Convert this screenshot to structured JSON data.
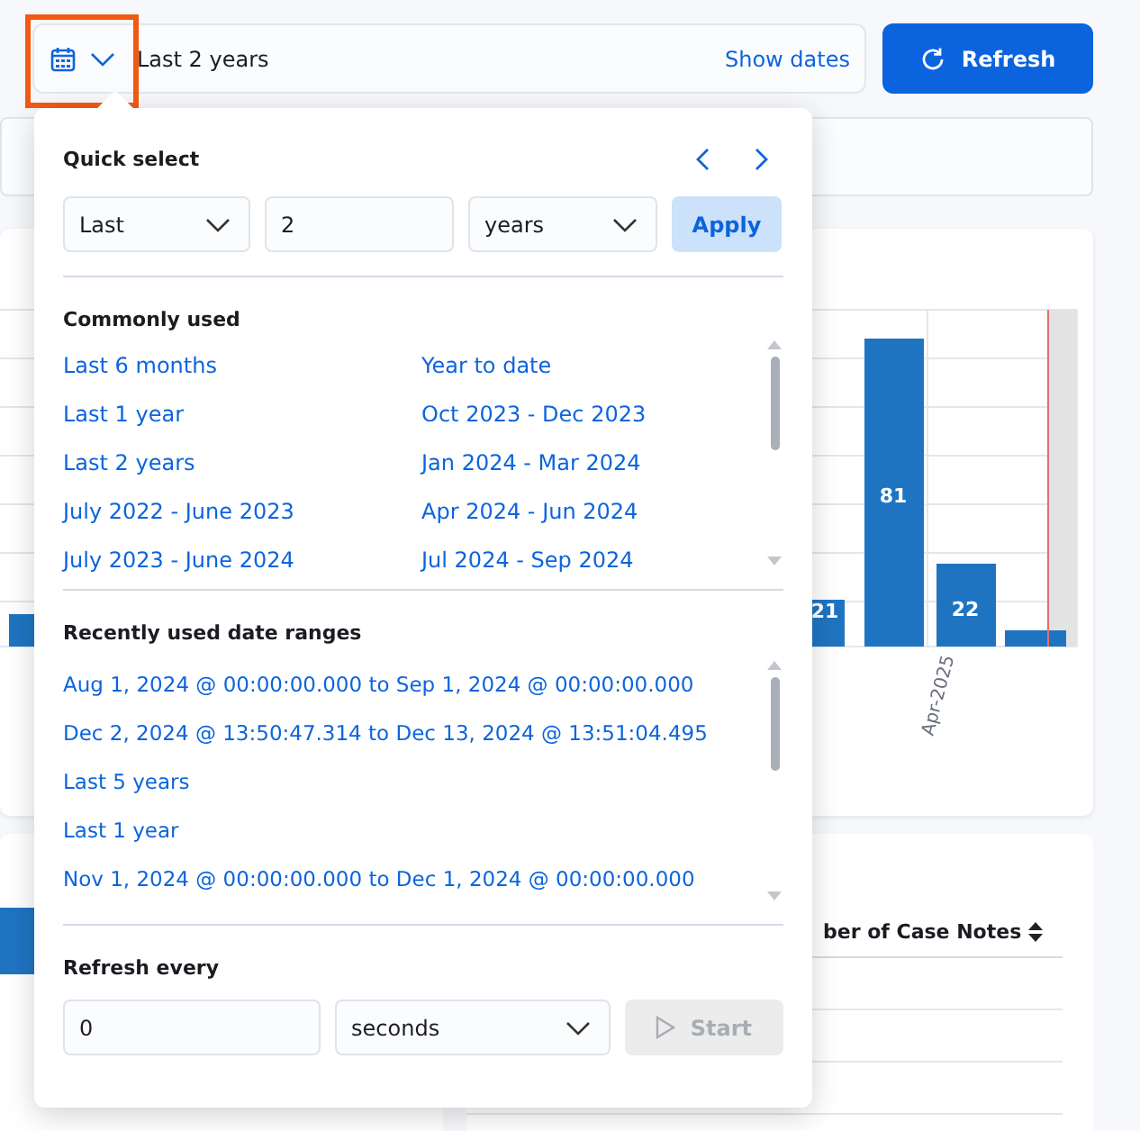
{
  "date_picker": {
    "value": "Last 2 years",
    "show_dates": "Show dates"
  },
  "refresh_button": "Refresh",
  "chart_panel": {
    "bar_labels": [
      "21",
      "81",
      "22"
    ],
    "axis_label": "Apr-2025"
  },
  "table_panel": {
    "column_header": "ber of Case Notes"
  },
  "popover": {
    "quick_select": {
      "title": "Quick select",
      "direction": "Last",
      "amount": "2",
      "unit": "years",
      "apply": "Apply"
    },
    "commonly_used": {
      "title": "Commonly used",
      "items": [
        {
          "label": "Last 6 months"
        },
        {
          "label": "Year to date"
        },
        {
          "label": "Last 1 year"
        },
        {
          "label": "Oct 2023 - Dec 2023"
        },
        {
          "label": "Last 2 years"
        },
        {
          "label": "Jan 2024 - Mar 2024"
        },
        {
          "label": "July 2022 - June 2023"
        },
        {
          "label": "Apr 2024 - Jun 2024"
        },
        {
          "label": "July 2023 - June 2024"
        },
        {
          "label": "Jul 2024 - Sep 2024"
        }
      ]
    },
    "recently_used": {
      "title": "Recently used date ranges",
      "items": [
        {
          "label": "Aug 1, 2024 @ 00:00:00.000 to Sep 1, 2024 @ 00:00:00.000"
        },
        {
          "label": "Dec 2, 2024 @ 13:50:47.314 to Dec 13, 2024 @ 13:51:04.495"
        },
        {
          "label": "Last 5 years"
        },
        {
          "label": "Last 1 year"
        },
        {
          "label": "Nov 1, 2024 @ 00:00:00.000 to Dec 1, 2024 @ 00:00:00.000"
        }
      ]
    },
    "refresh_every": {
      "title": "Refresh every",
      "interval": "0",
      "unit": "seconds",
      "start": "Start",
      "start_disabled": true
    }
  }
}
